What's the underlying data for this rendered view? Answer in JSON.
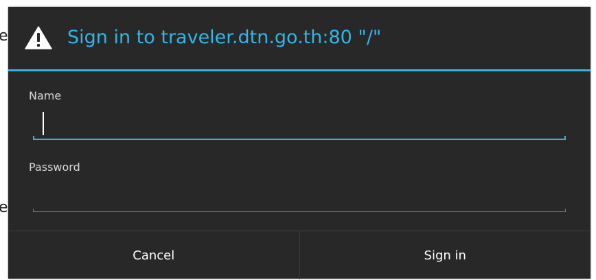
{
  "dialog": {
    "title": "Sign in to traveler.dtn.go.th:80 \"/\"",
    "accent_color": "#33b5e5",
    "background_color": "#282828",
    "icon": "warning-icon"
  },
  "form": {
    "name_label": "Name",
    "name_value": "",
    "password_label": "Password",
    "password_value": ""
  },
  "buttons": {
    "cancel_label": "Cancel",
    "sign_in_label": "Sign in"
  }
}
